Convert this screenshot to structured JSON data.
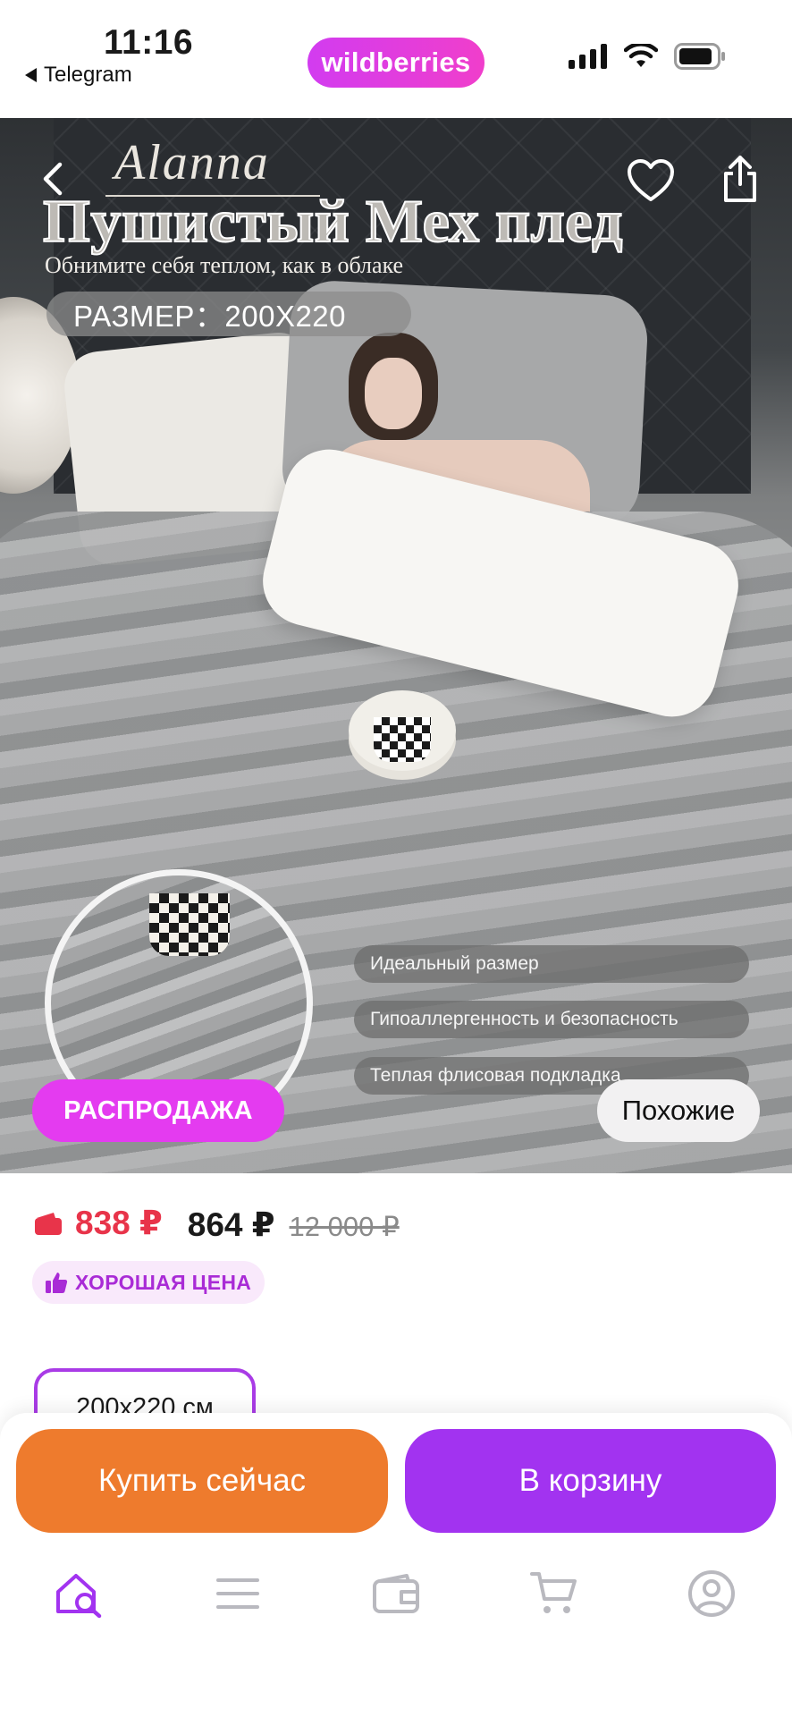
{
  "status_bar": {
    "time": "11:16",
    "back_app": "Telegram",
    "logo": "wildberries"
  },
  "hero": {
    "brand": "Alanna",
    "headline": "Пушистый Мех плед",
    "subline": "Обнимите себя теплом, как в облаке",
    "size_label": "РАЗМЕР：200X220",
    "features": [
      "Идеальный размер",
      "Гипоаллергенность и безопасность",
      "Теплая флисовая подкладка"
    ],
    "sale_badge": "РАСПРОДАЖА",
    "similar_button": "Похожие",
    "icons": {
      "back": "chevron-left-icon",
      "favorite": "heart-icon",
      "share": "share-icon"
    }
  },
  "price": {
    "wallet_price": "838 ₽",
    "price": "864 ₽",
    "old_price": "12 000 ₽",
    "good_price_badge": "ХОРОШАЯ ЦЕНА"
  },
  "variant": {
    "selected_size": "200х220 см"
  },
  "actions": {
    "buy_now": "Купить сейчас",
    "add_to_cart": "В корзину"
  },
  "tabbar": {
    "items": [
      "home-search-icon",
      "menu-icon",
      "wallet-icon",
      "cart-icon",
      "profile-icon"
    ],
    "active_color": "#a233f0",
    "inactive_color": "#b9b9bf"
  },
  "colors": {
    "brand_pink": "#e43bf0",
    "accent_purple": "#a233f0",
    "buy_orange": "#ee7b2d",
    "wallet_red": "#e8344a"
  }
}
